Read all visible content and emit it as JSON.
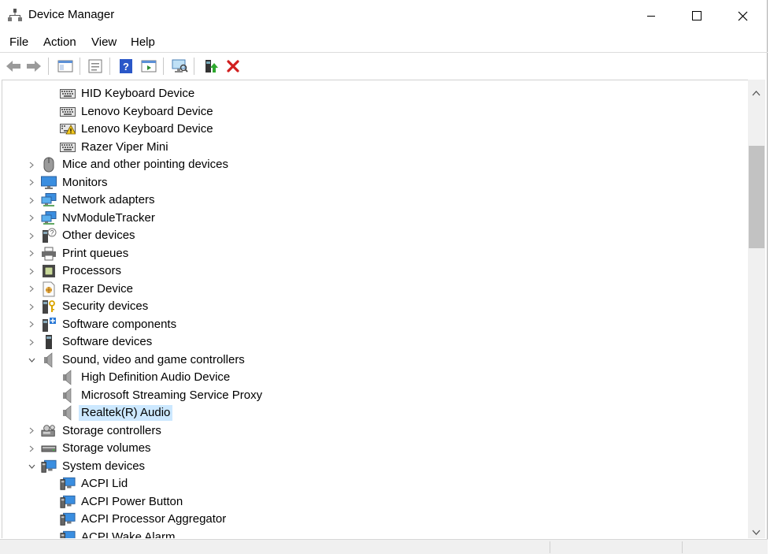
{
  "window": {
    "title": "Device Manager"
  },
  "menu": {
    "items": [
      "File",
      "Action",
      "View",
      "Help"
    ]
  },
  "toolbar": {
    "buttons": [
      "back-icon",
      "forward-icon",
      "show-hide-console-tree-icon",
      "properties-icon",
      "help-icon",
      "action-pane-icon",
      "scan-hardware-changes-icon",
      "update-driver-icon",
      "uninstall-device-icon"
    ]
  },
  "tree": {
    "items": [
      {
        "label": "HID Keyboard Device",
        "icon": "keyboard-icon",
        "level": 1
      },
      {
        "label": "Lenovo Keyboard Device",
        "icon": "keyboard-icon",
        "level": 1
      },
      {
        "label": "Lenovo Keyboard Device",
        "icon": "keyboard-warning-icon",
        "level": 1
      },
      {
        "label": "Razer Viper Mini",
        "icon": "keyboard-icon",
        "level": 1
      },
      {
        "label": "Mice and other pointing devices",
        "icon": "mouse-icon",
        "level": 0,
        "expanded": false
      },
      {
        "label": "Monitors",
        "icon": "monitor-icon",
        "level": 0,
        "expanded": false
      },
      {
        "label": "Network adapters",
        "icon": "network-adapter-icon",
        "level": 0,
        "expanded": false
      },
      {
        "label": "NvModuleTracker",
        "icon": "network-adapter-icon",
        "level": 0,
        "expanded": false
      },
      {
        "label": "Other devices",
        "icon": "unknown-device-icon",
        "level": 0,
        "expanded": false
      },
      {
        "label": "Print queues",
        "icon": "printer-icon",
        "level": 0,
        "expanded": false
      },
      {
        "label": "Processors",
        "icon": "processor-icon",
        "level": 0,
        "expanded": false
      },
      {
        "label": "Razer Device",
        "icon": "razer-device-icon",
        "level": 0,
        "expanded": false
      },
      {
        "label": "Security devices",
        "icon": "security-device-icon",
        "level": 0,
        "expanded": false
      },
      {
        "label": "Software components",
        "icon": "software-component-icon",
        "level": 0,
        "expanded": false
      },
      {
        "label": "Software devices",
        "icon": "software-device-icon",
        "level": 0,
        "expanded": false
      },
      {
        "label": "Sound, video and game controllers",
        "icon": "speaker-icon",
        "level": 0,
        "expanded": true
      },
      {
        "label": "High Definition Audio Device",
        "icon": "speaker-icon",
        "level": 1
      },
      {
        "label": "Microsoft Streaming Service Proxy",
        "icon": "speaker-icon",
        "level": 1
      },
      {
        "label": "Realtek(R) Audio",
        "icon": "speaker-icon",
        "level": 1,
        "selected": true
      },
      {
        "label": "Storage controllers",
        "icon": "storage-controller-icon",
        "level": 0,
        "expanded": false
      },
      {
        "label": "Storage volumes",
        "icon": "storage-volume-icon",
        "level": 0,
        "expanded": false
      },
      {
        "label": "System devices",
        "icon": "system-device-icon",
        "level": 0,
        "expanded": true
      },
      {
        "label": "ACPI Lid",
        "icon": "system-device-icon",
        "level": 1
      },
      {
        "label": "ACPI Power Button",
        "icon": "system-device-icon",
        "level": 1
      },
      {
        "label": "ACPI Processor Aggregator",
        "icon": "system-device-icon",
        "level": 1
      },
      {
        "label": "ACPI Wake Alarm",
        "icon": "system-device-icon",
        "level": 1
      }
    ]
  },
  "colors": {
    "selection": "#cce8ff",
    "accent": "#1e6fd9",
    "uninstall": "#d11f1f"
  }
}
